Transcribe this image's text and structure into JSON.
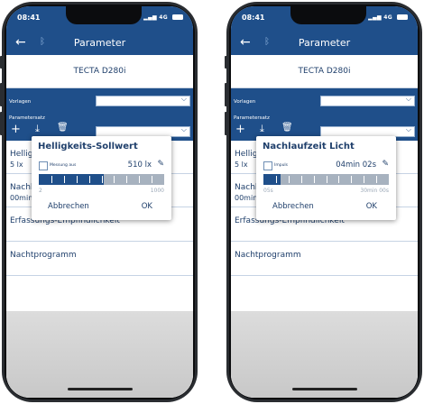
{
  "status": {
    "time": "08:41",
    "network": "4G"
  },
  "appbar": {
    "back_icon": "arrow-left-icon",
    "bluetooth_icon": "bluetooth-icon",
    "title": "Parameter"
  },
  "device": "TECTA D280i",
  "panel": {
    "vorlagen_label": "Vorlagen",
    "parametersatz_label": "Parametersatz",
    "vorlagen_value": "",
    "parametersatz_value": "",
    "tools": [
      "plus-icon",
      "download-icon",
      "delete-icon"
    ]
  },
  "list": [
    {
      "title": "Helligkeits-Sollwert",
      "value": "5 lx"
    },
    {
      "title": "Nachlaufzeit Licht",
      "value": "00min 30s"
    },
    {
      "title": "Erfassungs-Empfindlichkeit",
      "value": ""
    },
    {
      "title": "Nachtprogramm",
      "value": ""
    }
  ],
  "left_dialog": {
    "title": "Helligkeits-Sollwert",
    "checkbox_label": "Messung aus",
    "value": "510 lx",
    "min": "2",
    "max": "1000",
    "fill_fraction": 0.52,
    "cancel": "Abbrechen",
    "ok": "OK"
  },
  "right_dialog": {
    "title": "Nachlaufzeit Licht",
    "checkbox_label": "Impuls",
    "value": "04min 02s",
    "min": "05s",
    "max": "30min 00s",
    "fill_fraction": 0.14,
    "cancel": "Abbrechen",
    "ok": "OK"
  },
  "colors": {
    "primary": "#1f4f8a",
    "text": "#1f3f6b",
    "track": "#a7b2bf"
  }
}
